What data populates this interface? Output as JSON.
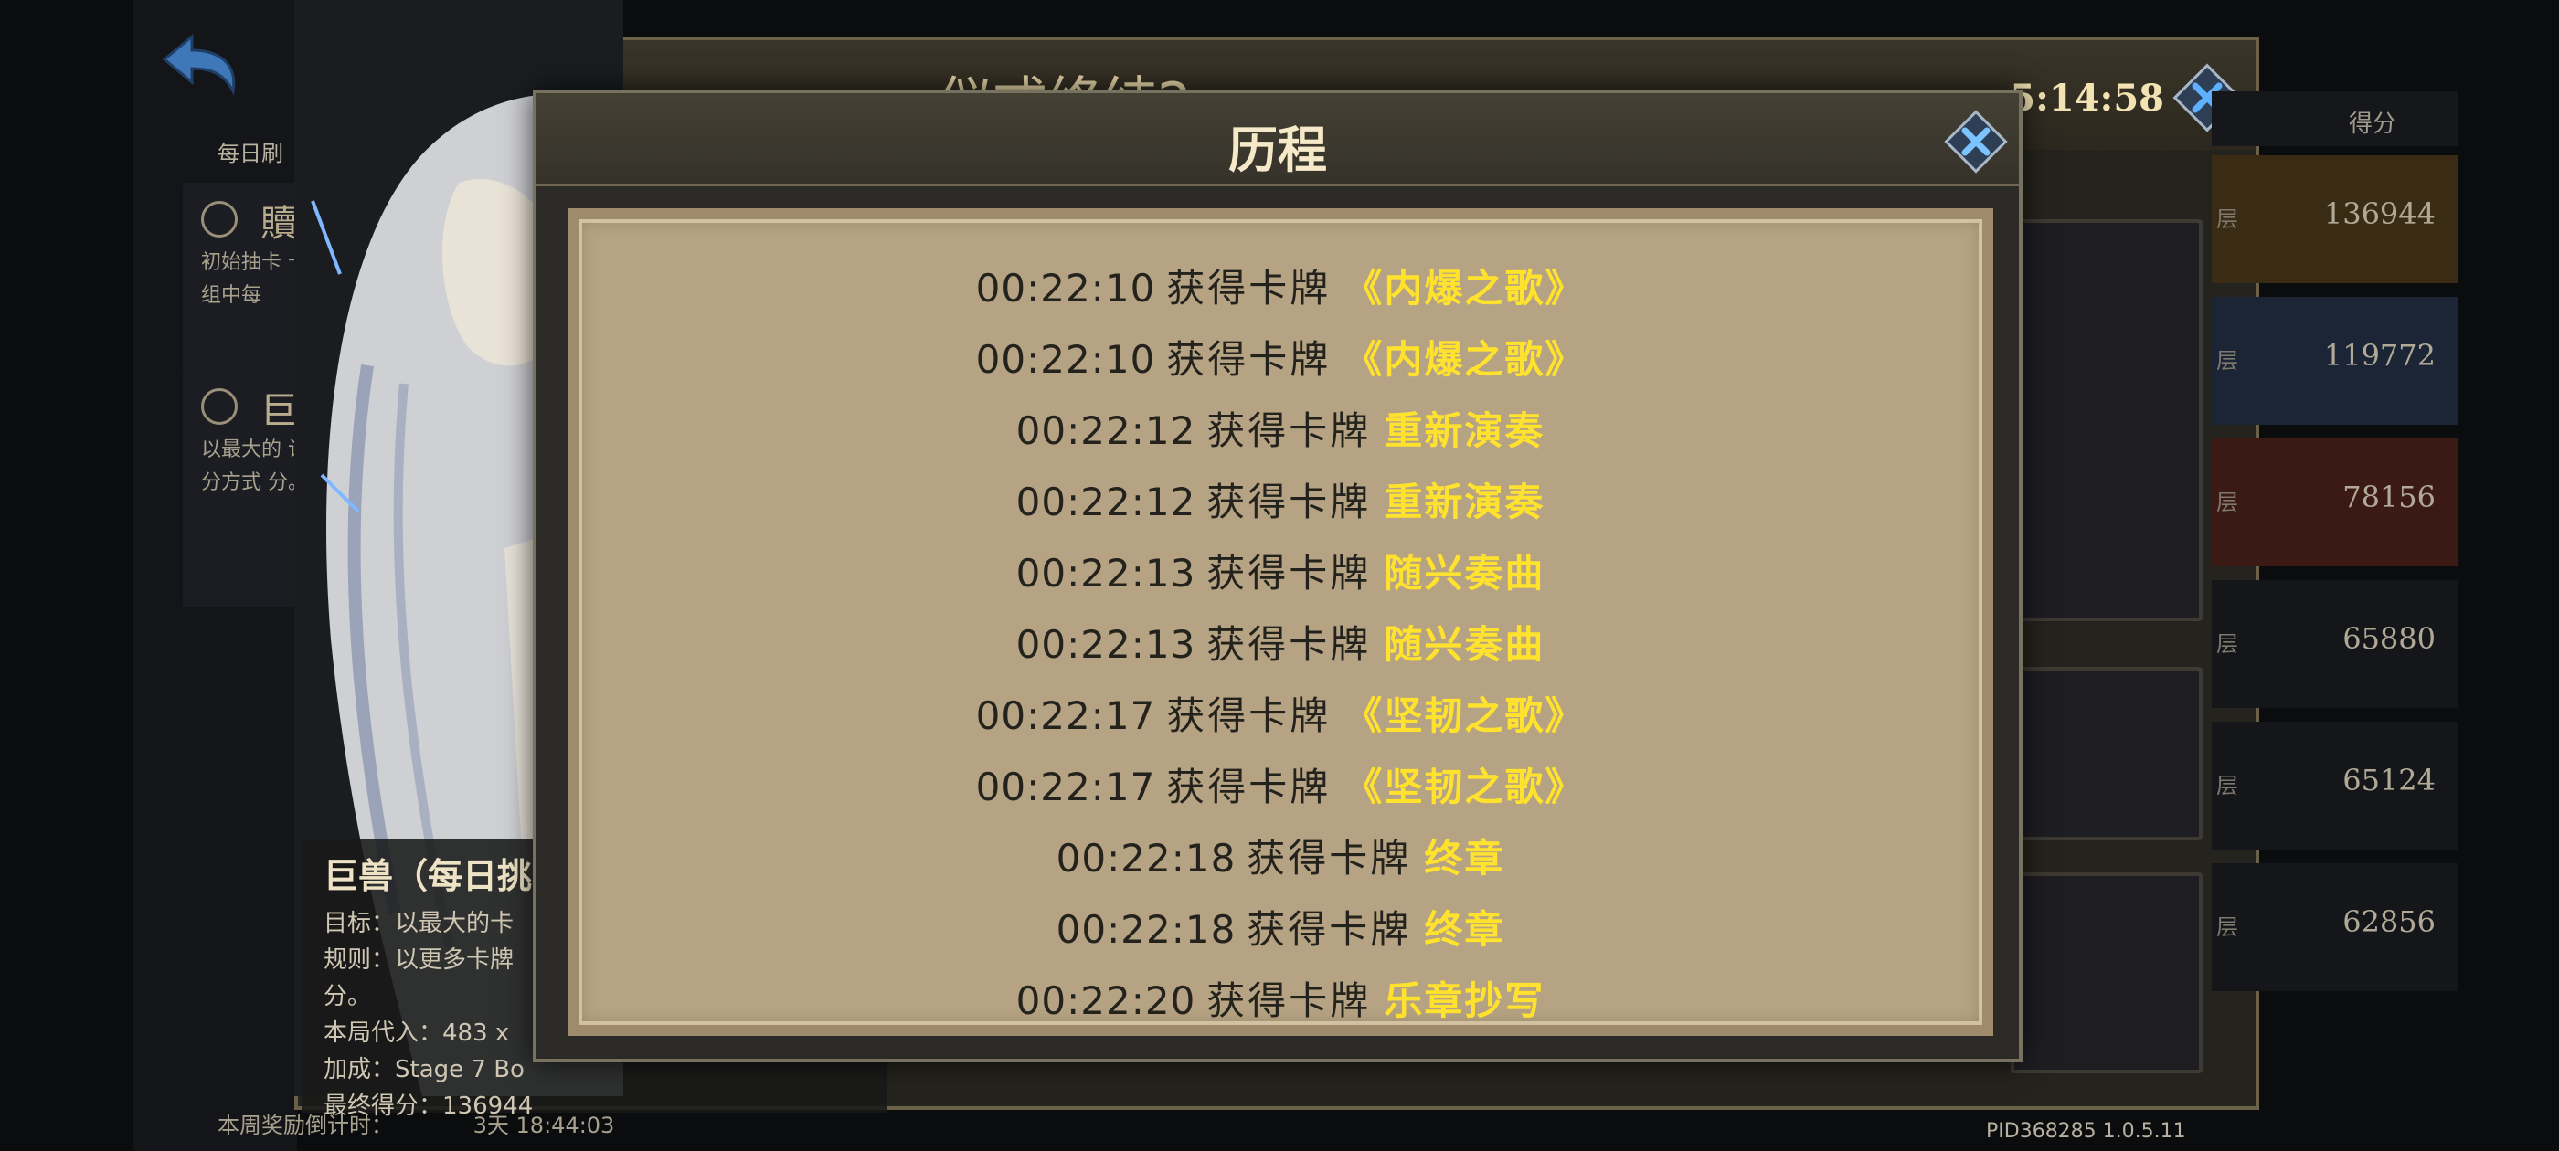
{
  "background": {
    "daily_label": "每日刷",
    "modes": [
      {
        "title": "贖",
        "desc": "初始抽卡 卡组中每"
      },
      {
        "title": "巨",
        "desc": "以最大的 计分方式 分。"
      }
    ],
    "window_title": "仪式终结2",
    "timer": "5:14:58",
    "score_header": "得分",
    "rank_mark": "层",
    "scores": [
      "136944",
      "119772",
      "78156",
      "65880",
      "65124",
      "62856"
    ],
    "reward_label": "本周奖励倒计时：",
    "reward_time": "3天 18:44:03",
    "footer_id": "PID368285  1.0.5.11"
  },
  "character_info": {
    "title": "巨兽（每日挑",
    "lines": [
      "目标：以最大的卡",
      "规则：以更多卡牌",
      "分。",
      "本局代入：483 x",
      "加成：Stage 7 Bo",
      "最终得分：136944"
    ]
  },
  "dialog": {
    "title": "历程",
    "entries": [
      {
        "time": "00:22:10",
        "action": "获得卡牌",
        "card": "《内爆之歌》"
      },
      {
        "time": "00:22:10",
        "action": "获得卡牌",
        "card": "《内爆之歌》"
      },
      {
        "time": "00:22:12",
        "action": "获得卡牌",
        "card": "重新演奏"
      },
      {
        "time": "00:22:12",
        "action": "获得卡牌",
        "card": "重新演奏"
      },
      {
        "time": "00:22:13",
        "action": "获得卡牌",
        "card": "随兴奏曲"
      },
      {
        "time": "00:22:13",
        "action": "获得卡牌",
        "card": "随兴奏曲"
      },
      {
        "time": "00:22:17",
        "action": "获得卡牌",
        "card": "《坚韧之歌》"
      },
      {
        "time": "00:22:17",
        "action": "获得卡牌",
        "card": "《坚韧之歌》"
      },
      {
        "time": "00:22:18",
        "action": "获得卡牌",
        "card": "终章"
      },
      {
        "time": "00:22:18",
        "action": "获得卡牌",
        "card": "终章"
      },
      {
        "time": "00:22:20",
        "action": "获得卡牌",
        "card": "乐章抄写"
      }
    ]
  },
  "icons": {
    "back": "back-arrow-icon",
    "close": "close-icon"
  },
  "colors": {
    "card_name": "#ffe22e",
    "paper": "#b5a383",
    "log_text": "#24221c"
  }
}
